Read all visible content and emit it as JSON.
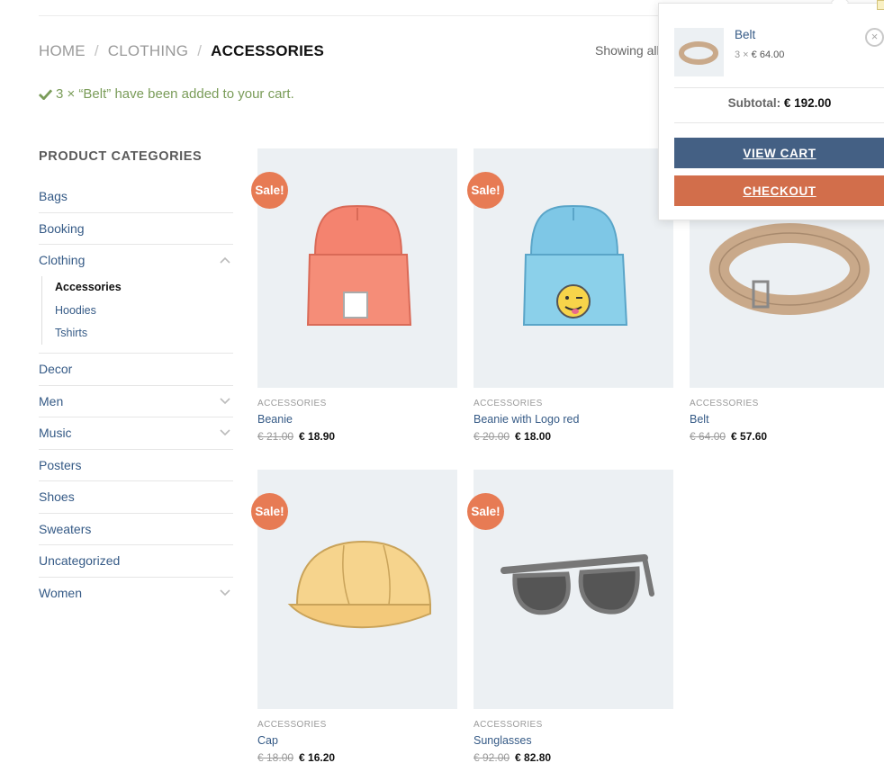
{
  "breadcrumb": {
    "home": "HOME",
    "separator": "/",
    "clothing": "CLOTHING",
    "current": "ACCESSORIES"
  },
  "result_count": "Showing all",
  "notice": {
    "icon": "checkmark-icon",
    "text": "3 × “Belt” have been added to your cart.",
    "color": "#7a9c59"
  },
  "sidebar": {
    "title": "PRODUCT CATEGORIES",
    "categories": [
      {
        "label": "Bags",
        "has_toggle": false
      },
      {
        "label": "Booking",
        "has_toggle": false
      },
      {
        "label": "Clothing",
        "has_toggle": true,
        "expanded": true,
        "children": [
          "Accessories",
          "Hoodies",
          "Tshirts"
        ]
      },
      {
        "label": "Decor",
        "has_toggle": false
      },
      {
        "label": "Men",
        "has_toggle": true
      },
      {
        "label": "Music",
        "has_toggle": true
      },
      {
        "label": "Posters",
        "has_toggle": false
      },
      {
        "label": "Shoes",
        "has_toggle": false
      },
      {
        "label": "Sweaters",
        "has_toggle": false
      },
      {
        "label": "Uncategorized",
        "has_toggle": false
      },
      {
        "label": "Women",
        "has_toggle": true
      }
    ],
    "active_child": "Accessories"
  },
  "products": [
    {
      "badge": "Sale!",
      "category": "ACCESSORIES",
      "name": "Beanie",
      "old_price": "€ 21.00",
      "price": "€ 18.90"
    },
    {
      "badge": "Sale!",
      "category": "ACCESSORIES",
      "name": "Beanie with Logo red",
      "old_price": "€ 20.00",
      "price": "€ 18.00"
    },
    {
      "badge": "",
      "category": "ACCESSORIES",
      "name": "Belt",
      "old_price": "€ 64.00",
      "price": "€ 57.60"
    },
    {
      "badge": "Sale!",
      "category": "ACCESSORIES",
      "name": "Cap",
      "old_price": "€ 18.00",
      "price": "€ 16.20"
    },
    {
      "badge": "Sale!",
      "category": "ACCESSORIES",
      "name": "Sunglasses",
      "old_price": "€ 92.00",
      "price": "€ 82.80"
    }
  ],
  "mini_cart": {
    "item_name": "Belt",
    "qty": "3 ×",
    "item_price": "€ 64.00",
    "remove": "×",
    "subtotal_label": "Subtotal:",
    "subtotal_amount": "€ 192.00",
    "view_cart": "VIEW CART",
    "checkout": "CHECKOUT"
  },
  "colors": {
    "link": "#355a86",
    "sale_badge": "#e77b54",
    "view_cart_button": "#446084",
    "checkout_button": "#d26e4b",
    "image_bg": "#ecf0f3"
  }
}
